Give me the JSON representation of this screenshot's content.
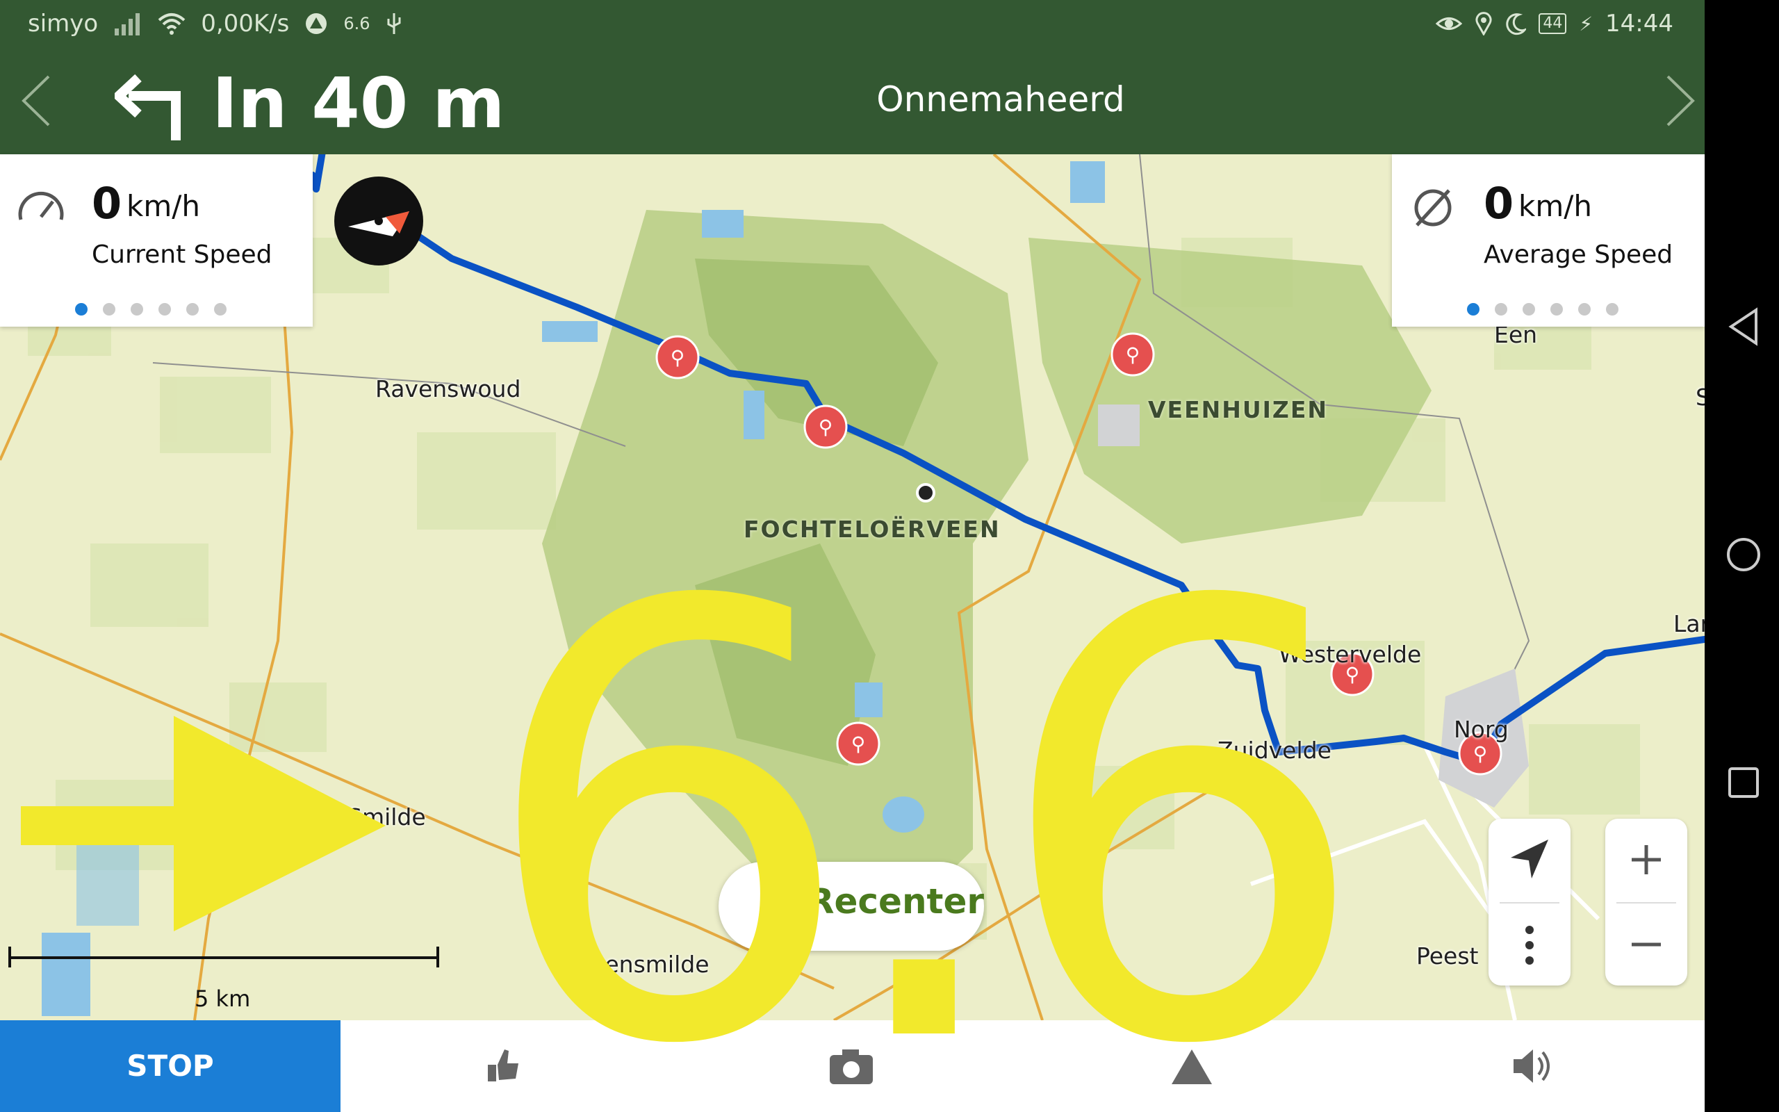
{
  "status_bar": {
    "carrier": "simyo",
    "data_speed": "0,00K/s",
    "app_badge": "6.6",
    "battery": "44",
    "time": "14:44"
  },
  "navigation": {
    "distance": "In 40 m",
    "street": "Onnemaheerd"
  },
  "speed_cards": [
    {
      "value": "0",
      "unit": "km/h",
      "label": "Current Speed",
      "icon": "speedometer-icon",
      "page_dots": 6,
      "active_dot": 0
    },
    {
      "value": "0",
      "unit": "km/h",
      "label": "Average Speed",
      "icon": "average-icon",
      "page_dots": 6,
      "active_dot": 0
    }
  ],
  "map": {
    "labels": {
      "ravenswoud": "Ravenswoud",
      "veenhuizen": "VEENHUIZEN",
      "fochteloerveen": "FOCHTELOËRVEEN",
      "westervelde": "Westervelde",
      "zuidvelde": "Zuidvelde",
      "norg": "Norg",
      "een": "Een",
      "peest": "Peest",
      "bovensmilde": "Bovensmilde",
      "smilde": "Smilde",
      "langelo": "Lar",
      "s_cut": "S"
    },
    "scale_label": "5 km",
    "recenter_label": "Recenter",
    "route_color": "#0a52c4",
    "poi_color": "#e5504f"
  },
  "bottom_bar": {
    "stop_label": "STOP"
  },
  "overlay": {
    "text": "6.6",
    "color": "#f2e92c"
  }
}
